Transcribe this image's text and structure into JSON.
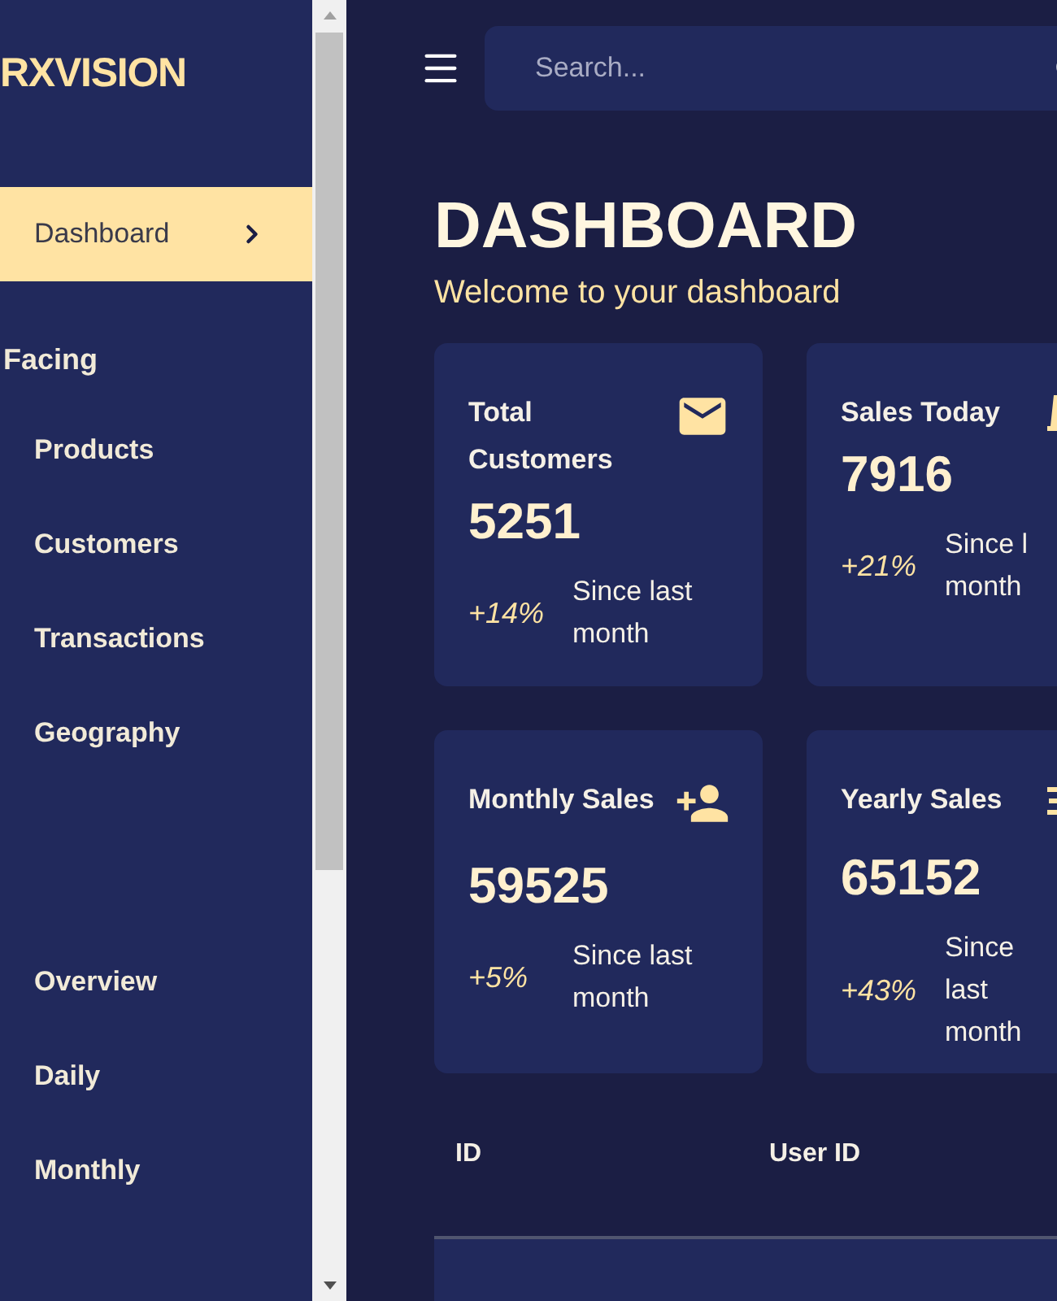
{
  "sidebar": {
    "brand": "RXVISION",
    "nav": [
      {
        "label": "Dashboard",
        "selected": true
      }
    ],
    "groups": [
      {
        "title": "Facing",
        "items": [
          {
            "label": "Products",
            "selected": false
          },
          {
            "label": "Customers",
            "selected": false
          },
          {
            "label": "Transactions",
            "selected": false
          },
          {
            "label": "Geography",
            "selected": false
          }
        ]
      },
      {
        "items": [
          {
            "label": "Overview",
            "selected": false
          },
          {
            "label": "Daily",
            "selected": false
          },
          {
            "label": "Monthly",
            "selected": false
          }
        ]
      }
    ]
  },
  "topbar": {
    "search": {
      "placeholder": "Search..."
    }
  },
  "header": {
    "title": "DASHBOARD",
    "subtitle": "Welcome to your dashboard"
  },
  "stats": [
    {
      "title": "Total Customers",
      "value": "5251",
      "change": "+14%",
      "note_lines": [
        "Since last",
        "month"
      ]
    },
    {
      "title": "Sales Today",
      "value": "7916",
      "change": "+21%",
      "note_lines": [
        "Since l",
        "month"
      ]
    },
    {
      "title": "Monthly Sales",
      "value": "59525",
      "change": "+5%",
      "note_lines": [
        "Since last",
        "month"
      ]
    },
    {
      "title": "Yearly Sales",
      "value": "65152",
      "change": "+43%",
      "note_lines": [
        "Since",
        "last",
        "month"
      ]
    }
  ],
  "table": {
    "columns": [
      "ID",
      "User ID"
    ]
  }
}
